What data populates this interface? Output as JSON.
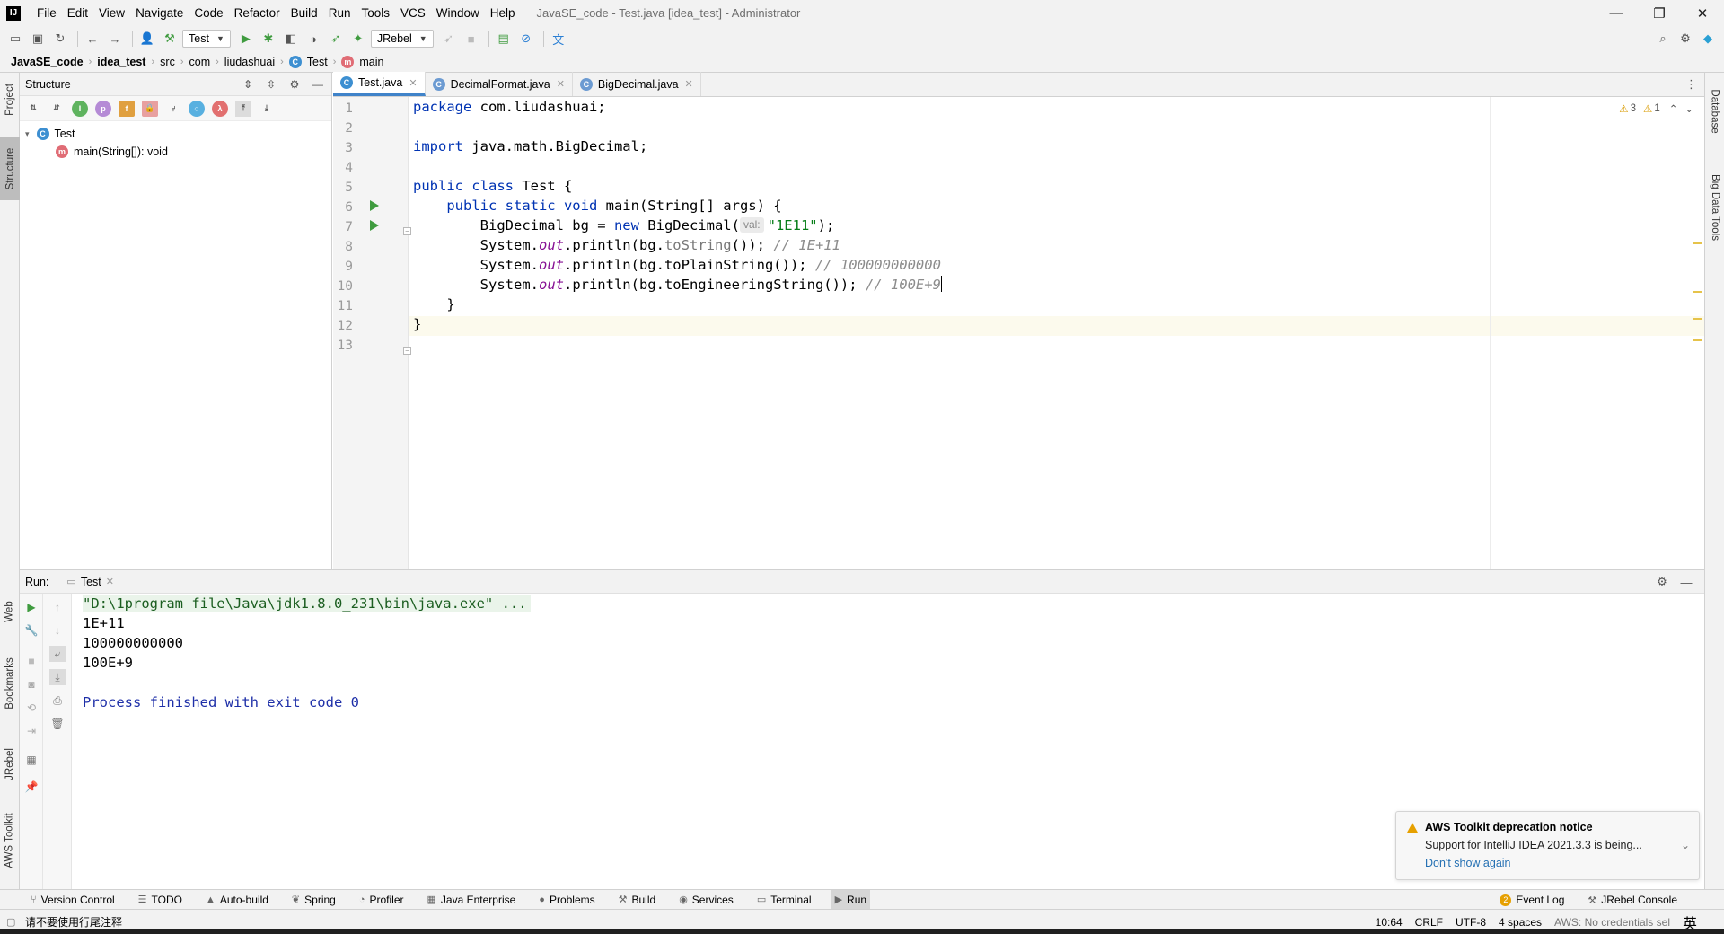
{
  "window": {
    "title": "JavaSE_code - Test.java [idea_test] - Administrator",
    "logo": "IJ",
    "controls": [
      "—",
      "❐",
      "✕"
    ]
  },
  "menu": [
    "File",
    "Edit",
    "View",
    "Navigate",
    "Code",
    "Refactor",
    "Build",
    "Run",
    "Tools",
    "VCS",
    "Window",
    "Help"
  ],
  "toolbar": {
    "run_config": "Test",
    "jrebel": "JRebel"
  },
  "breadcrumb": [
    "JavaSE_code",
    "idea_test",
    "src",
    "com",
    "liudashuai",
    "Test",
    "main"
  ],
  "left_strip": {
    "tabs": [
      "Project",
      "Structure",
      "Web",
      "Bookmarks",
      "JRebel",
      "AWS Toolkit"
    ]
  },
  "right_strip": {
    "tabs": [
      "Database",
      "Big Data Tools"
    ]
  },
  "structure": {
    "title": "Structure",
    "tree": [
      {
        "label": "Test",
        "icon": "C"
      },
      {
        "label": "main(String[]): void",
        "icon": "m"
      }
    ]
  },
  "editor": {
    "tabs": [
      {
        "label": "Test.java",
        "active": true
      },
      {
        "label": "DecimalFormat.java",
        "active": false
      },
      {
        "label": "BigDecimal.java",
        "active": false
      }
    ],
    "line_numbers": [
      "1",
      "2",
      "3",
      "4",
      "5",
      "6",
      "7",
      "8",
      "9",
      "10",
      "11",
      "12",
      "13"
    ],
    "inspections": {
      "warnings": "3",
      "weak_warnings": "1"
    },
    "code": {
      "l1_kw": "package",
      "l1_rest": " com.liudashuai;",
      "l3_kw": "import",
      "l3_rest": " java.math.BigDecimal;",
      "l5_kw": "public class",
      "l5_rest": " Test {",
      "l6_indent": "    ",
      "l6_kw": "public static void",
      "l6_rest": " main(String[] args) {",
      "l7_a": "        BigDecimal bg = ",
      "l7_kw": "new",
      "l7_b": " BigDecimal(",
      "l7_hint": "val:",
      "l7_str": "\"1E11\"",
      "l7_c": ");",
      "l8_a": "        System.",
      "l8_fld": "out",
      "l8_b": ".println(bg.",
      "l8_c": "toString",
      "l8_d": "()); ",
      "l8_cmt": "// 1E+11",
      "l9_a": "        System.",
      "l9_fld": "out",
      "l9_b": ".println(bg.toPlainString()); ",
      "l9_cmt": "// 100000000000",
      "l10_a": "        System.",
      "l10_fld": "out",
      "l10_b": ".println(bg.toEngineeringString()); ",
      "l10_cmt": "// 100E+9",
      "l11": "    }",
      "l12": "}"
    }
  },
  "run": {
    "label": "Run:",
    "tab": "Test",
    "console": [
      "\"D:\\1program file\\Java\\jdk1.8.0_231\\bin\\java.exe\" ...",
      "1E+11",
      "100000000000",
      "100E+9",
      "",
      "Process finished with exit code 0"
    ]
  },
  "notification": {
    "title": "AWS Toolkit deprecation notice",
    "body": "Support for IntelliJ IDEA 2021.3.3 is being...",
    "link": "Don't show again"
  },
  "bottom_tools": [
    {
      "label": "Version Control",
      "icon": "⑂"
    },
    {
      "label": "TODO",
      "icon": "☰"
    },
    {
      "label": "Auto-build",
      "icon": "▲"
    },
    {
      "label": "Spring",
      "icon": "❦"
    },
    {
      "label": "Profiler",
      "icon": "◔"
    },
    {
      "label": "Java Enterprise",
      "icon": "▦"
    },
    {
      "label": "Problems",
      "icon": "●"
    },
    {
      "label": "Build",
      "icon": "⚒"
    },
    {
      "label": "Services",
      "icon": "◉"
    },
    {
      "label": "Terminal",
      "icon": "▭"
    },
    {
      "label": "Run",
      "icon": "▶",
      "active": true
    }
  ],
  "bottom_right_tools": {
    "event_log": "Event Log",
    "event_count": "2",
    "jrebel_console": "JRebel Console"
  },
  "status": {
    "message": "请不要使用行尾注释",
    "position": "10:64",
    "line_sep": "CRLF",
    "encoding": "UTF-8",
    "indent": "4 spaces",
    "aws": "AWS: No credentials sel",
    "ime": "英"
  },
  "colors": {
    "keyword": "#0033b3",
    "string": "#067d17",
    "comment": "#8c8c8c",
    "field": "#871094",
    "exit_text": "#1e2fa8",
    "tab_accent": "#4083c9"
  }
}
